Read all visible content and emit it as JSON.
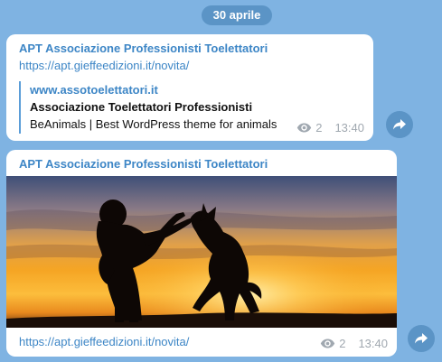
{
  "date_badge": "30 aprile",
  "messages": [
    {
      "channel": "APT Associazione Professionisti Toelettatori",
      "link": "https://apt.gieffeedizioni.it/novita/",
      "preview": {
        "site": "www.assotoelettatori.it",
        "title": "Associazione Toelettatori Professionisti",
        "description": "BeAnimals | Best WordPress theme for animals"
      },
      "views": "2",
      "time": "13:40",
      "share_icon": "share-arrow-icon"
    },
    {
      "channel": "APT Associazione Professionisti Toelettatori",
      "image": "silhouette of a person playing with a jumping dog at sunset",
      "link": "https://apt.gieffeedizioni.it/novita/",
      "views": "2",
      "time": "13:40",
      "share_icon": "share-arrow-icon"
    }
  ],
  "colors": {
    "background": "#7fb3e2",
    "accent": "#3d86c6",
    "badge": "#5b94c6",
    "meta": "#a0a8b0"
  }
}
